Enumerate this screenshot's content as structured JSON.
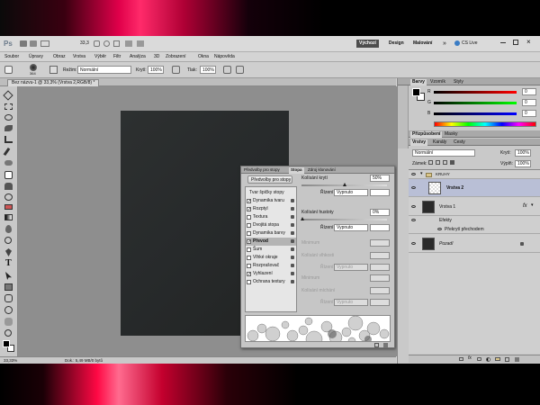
{
  "app": {
    "logo": "Ps",
    "zoom": "33,3",
    "workspaces": {
      "default": "Výchozí",
      "design": "Design",
      "painting": "Malování",
      "more": "»"
    },
    "cslive": "CS Live"
  },
  "menu": [
    "Soubor",
    "Úpravy",
    "Obraz",
    "Vrstva",
    "Výběr",
    "Filtr",
    "Analýza",
    "3D",
    "Zobrazení",
    "Okna",
    "Nápověda"
  ],
  "options": {
    "brush_size": "364",
    "mode_label": "Režim:",
    "mode_value": "Normální",
    "opacity_label": "Krytí:",
    "opacity_value": "100%",
    "flow_label": "Tlak:",
    "flow_value": "100%"
  },
  "document": {
    "tab": "Bez názvu-1 @ 33,3% (Vrstva 2,RGB/8) *",
    "canvas_color": "#2b2b2b"
  },
  "status": {
    "zoom": "33,33%",
    "doc": "Dok.: 5,49 MB/0 bytů"
  },
  "brush_panel": {
    "tabs": [
      "Předvolby pro stopy",
      "Stopa",
      "Zdroj klonování"
    ],
    "presets_button": "Předvolby pro stopy",
    "items": [
      {
        "label": "Tvar špičky stopy",
        "checked": false,
        "checkbox": false
      },
      {
        "label": "Dynamika tvaru",
        "checked": true,
        "checkbox": true
      },
      {
        "label": "Rozptyl",
        "checked": true,
        "checkbox": true
      },
      {
        "label": "Textura",
        "checked": false,
        "checkbox": true
      },
      {
        "label": "Dvojitá stopa",
        "checked": false,
        "checkbox": true
      },
      {
        "label": "Dynamika barvy",
        "checked": false,
        "checkbox": true
      },
      {
        "label": "Převod",
        "checked": true,
        "checkbox": true
      },
      {
        "label": "Šum",
        "checked": false,
        "checkbox": true
      },
      {
        "label": "Vlhké okraje",
        "checked": false,
        "checkbox": true
      },
      {
        "label": "Rozprašovač",
        "checked": false,
        "checkbox": true
      },
      {
        "label": "Vyhlazení",
        "checked": true,
        "checkbox": true
      },
      {
        "label": "Ochrana textury",
        "checked": false,
        "checkbox": true
      }
    ],
    "opacity_jitter_label": "Kolísání krytí",
    "opacity_jitter_value": "50%",
    "control_label": "Řízení:",
    "control_value": "Vypnuto",
    "flow_jitter_label": "Kolísání hustoty",
    "flow_jitter_value": "0%",
    "control2_label": "Řízení:",
    "control2_value": "Vypnuto",
    "minimum_label": "Minimum",
    "wet_label": "Kolísání vlhkosti",
    "control3_label": "Řízení:",
    "control3_value": "Vypnuto",
    "minimum2_label": "Minimum",
    "mix_label": "Kolísání míchání",
    "control4_label": "Řízení:",
    "control4_value": "Vypnuto"
  },
  "color_panel": {
    "tabs": [
      "Barvy",
      "Vzorník",
      "Styly"
    ],
    "labels": [
      "R",
      "G",
      "B"
    ],
    "values": [
      "0",
      "0",
      "0"
    ]
  },
  "adjust_panel": {
    "tabs": [
      "Přizpůsobení",
      "Masky"
    ]
  },
  "layers_panel": {
    "tabs": [
      "Vrstvy",
      "Kanály",
      "Cesty"
    ],
    "blend": "Normální",
    "opacity_label": "Krytí:",
    "opacity_value": "100%",
    "lock_label": "Zámek:",
    "fill_label": "Výplň:",
    "fill_value": "100%",
    "layers": [
      {
        "name": "KRUHY",
        "type": "group"
      },
      {
        "name": "Vrstva 2",
        "type": "layer",
        "selected": true
      },
      {
        "name": "Vrstva 1",
        "type": "layer",
        "fx": "fx"
      },
      {
        "name": "Efekty",
        "type": "effects"
      },
      {
        "name": "Překrytí přechodem",
        "type": "effect"
      },
      {
        "name": "Pozadí",
        "type": "background"
      }
    ]
  },
  "colors": {
    "accent": "#2f6fbf",
    "selected_row": "#b9bfd6",
    "panel": "#c9c9c9"
  }
}
